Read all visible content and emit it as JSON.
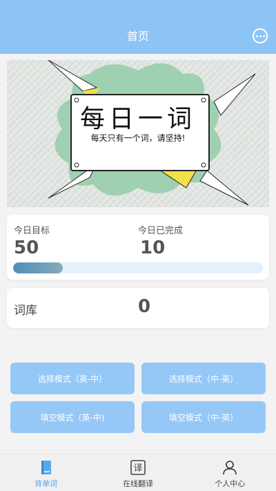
{
  "header": {
    "title": "首页",
    "menu_icon": "chat-bubble-icon"
  },
  "banner": {
    "title": "每日一词",
    "subtitle": "每天只有一个词，请坚持!"
  },
  "stats": {
    "goal_label": "今日目标",
    "goal_value": "50",
    "done_label": "今日已完成",
    "done_value": "10",
    "progress_fraction": 0.2
  },
  "library": {
    "label": "词库",
    "value": "0"
  },
  "modes": [
    {
      "label": "选择模式（英-中）"
    },
    {
      "label": "选择模式（中-英）"
    },
    {
      "label": "填空模式（英-中)"
    },
    {
      "label": "填空模式（中-英）"
    }
  ],
  "tabbar": {
    "items": [
      {
        "label": "背单词",
        "icon": "book-icon",
        "active": true
      },
      {
        "label": "在线翻译",
        "icon": "translate-icon",
        "active": false
      },
      {
        "label": "个人中心",
        "icon": "person-icon",
        "active": false
      }
    ]
  },
  "colors": {
    "header": "#8cc4f6",
    "button": "#95c8f7",
    "active_tab": "#5aa6e8"
  }
}
